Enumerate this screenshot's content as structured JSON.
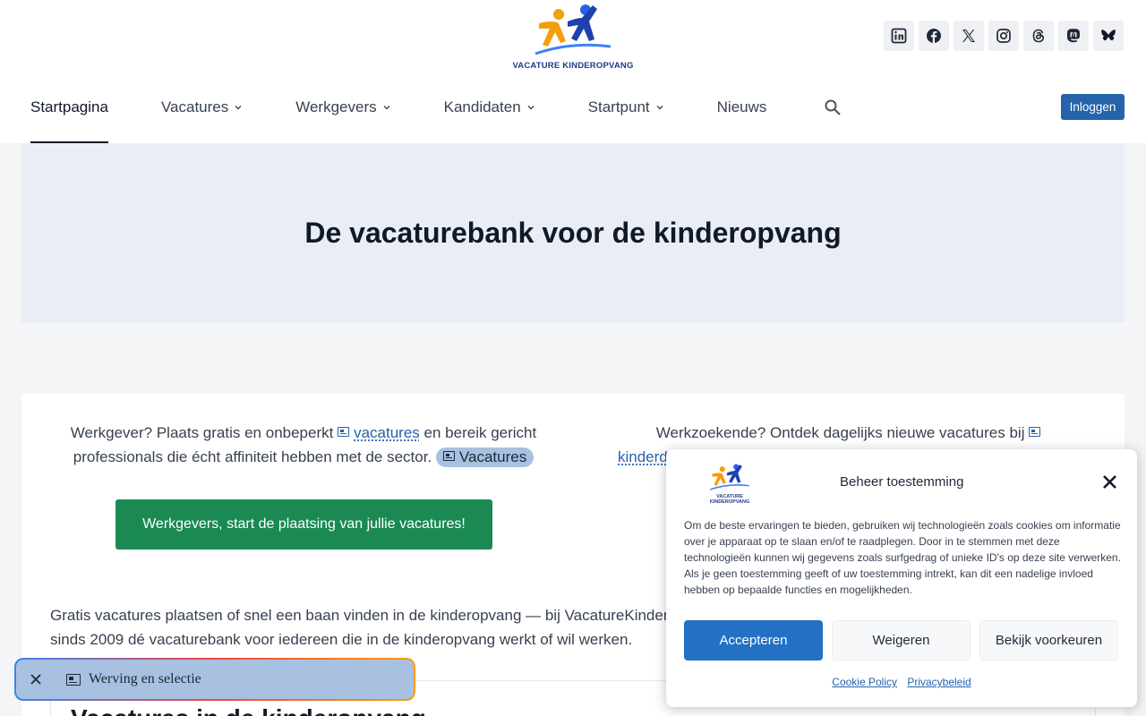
{
  "header": {
    "logo_text": "VACATURE KINDEROPVANG",
    "socials": [
      "linkedin-icon",
      "facebook-icon",
      "x-icon",
      "instagram-icon",
      "threads-icon",
      "mastodon-icon",
      "bluesky-icon"
    ],
    "nav": [
      {
        "label": "Startpagina",
        "active": true
      },
      {
        "label": "Vacatures",
        "dropdown": true
      },
      {
        "label": "Werkgevers",
        "dropdown": true
      },
      {
        "label": "Kandidaten",
        "dropdown": true
      },
      {
        "label": "Startpunt",
        "dropdown": true
      },
      {
        "label": "Nieuws"
      }
    ],
    "login_label": "Inloggen"
  },
  "hero": {
    "title": "De vacaturebank voor de kinderopvang"
  },
  "main": {
    "left_text_1": "Werkgever? Plaats gratis en onbeperkt",
    "left_link": "vacatures",
    "left_text_2": "en bereik gericht professionals die écht affiniteit hebben met de sector.",
    "left_pill": "Vacatures",
    "right_text_1": "Werkzoekende? Ontdek dagelijks nieuwe vacatures bij",
    "right_link": "kinderd",
    "cta_label": "Werkgevers, start de plaatsing van jullie vacatures!",
    "intro_line1": "Gratis vacatures plaatsen of snel een baan vinden in de kinderopvang — bij VacatureKinder",
    "intro_line2": "sinds 2009 dé vacaturebank voor iedereen die in de kinderopvang werkt of wil werken.",
    "section_title": "Vacatures in de kinderopvang"
  },
  "floating_tag": {
    "label": "Werving en selectie"
  },
  "cookie": {
    "logo_text": "VACATURE KINDEROPVANG",
    "title": "Beheer toestemming",
    "text": "Om de beste ervaringen te bieden, gebruiken wij technologieën zoals cookies om informatie over je apparaat op te slaan en/of te raadplegen. Door in te stemmen met deze technologieën kunnen wij gegevens zoals surfgedrag of unieke ID's op deze site verwerken. Als je geen toestemming geeft of uw toestemming intrekt, kan dit een nadelige invloed hebben op bepaalde functies en mogelijkheden.",
    "accept_label": "Accepteren",
    "deny_label": "Weigeren",
    "prefs_label": "Bekijk voorkeuren",
    "cookie_policy": "Cookie Policy",
    "privacy": "Privacybeleid"
  },
  "colors": {
    "accent": "#2563ab",
    "green": "#1a8a52",
    "hero_bg": "#e9eef6",
    "pill": "#a8c1e0"
  }
}
